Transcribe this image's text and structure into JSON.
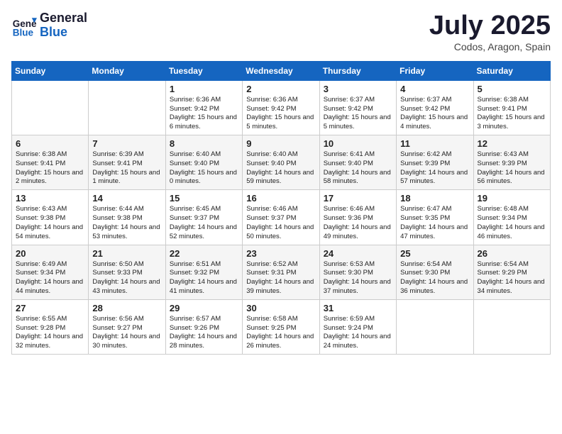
{
  "header": {
    "logo_line1": "General",
    "logo_line2": "Blue",
    "month_year": "July 2025",
    "location": "Codos, Aragon, Spain"
  },
  "weekdays": [
    "Sunday",
    "Monday",
    "Tuesday",
    "Wednesday",
    "Thursday",
    "Friday",
    "Saturday"
  ],
  "weeks": [
    [
      {
        "day": "",
        "info": ""
      },
      {
        "day": "",
        "info": ""
      },
      {
        "day": "1",
        "info": "Sunrise: 6:36 AM\nSunset: 9:42 PM\nDaylight: 15 hours and 6 minutes."
      },
      {
        "day": "2",
        "info": "Sunrise: 6:36 AM\nSunset: 9:42 PM\nDaylight: 15 hours and 5 minutes."
      },
      {
        "day": "3",
        "info": "Sunrise: 6:37 AM\nSunset: 9:42 PM\nDaylight: 15 hours and 5 minutes."
      },
      {
        "day": "4",
        "info": "Sunrise: 6:37 AM\nSunset: 9:42 PM\nDaylight: 15 hours and 4 minutes."
      },
      {
        "day": "5",
        "info": "Sunrise: 6:38 AM\nSunset: 9:41 PM\nDaylight: 15 hours and 3 minutes."
      }
    ],
    [
      {
        "day": "6",
        "info": "Sunrise: 6:38 AM\nSunset: 9:41 PM\nDaylight: 15 hours and 2 minutes."
      },
      {
        "day": "7",
        "info": "Sunrise: 6:39 AM\nSunset: 9:41 PM\nDaylight: 15 hours and 1 minute."
      },
      {
        "day": "8",
        "info": "Sunrise: 6:40 AM\nSunset: 9:40 PM\nDaylight: 15 hours and 0 minutes."
      },
      {
        "day": "9",
        "info": "Sunrise: 6:40 AM\nSunset: 9:40 PM\nDaylight: 14 hours and 59 minutes."
      },
      {
        "day": "10",
        "info": "Sunrise: 6:41 AM\nSunset: 9:40 PM\nDaylight: 14 hours and 58 minutes."
      },
      {
        "day": "11",
        "info": "Sunrise: 6:42 AM\nSunset: 9:39 PM\nDaylight: 14 hours and 57 minutes."
      },
      {
        "day": "12",
        "info": "Sunrise: 6:43 AM\nSunset: 9:39 PM\nDaylight: 14 hours and 56 minutes."
      }
    ],
    [
      {
        "day": "13",
        "info": "Sunrise: 6:43 AM\nSunset: 9:38 PM\nDaylight: 14 hours and 54 minutes."
      },
      {
        "day": "14",
        "info": "Sunrise: 6:44 AM\nSunset: 9:38 PM\nDaylight: 14 hours and 53 minutes."
      },
      {
        "day": "15",
        "info": "Sunrise: 6:45 AM\nSunset: 9:37 PM\nDaylight: 14 hours and 52 minutes."
      },
      {
        "day": "16",
        "info": "Sunrise: 6:46 AM\nSunset: 9:37 PM\nDaylight: 14 hours and 50 minutes."
      },
      {
        "day": "17",
        "info": "Sunrise: 6:46 AM\nSunset: 9:36 PM\nDaylight: 14 hours and 49 minutes."
      },
      {
        "day": "18",
        "info": "Sunrise: 6:47 AM\nSunset: 9:35 PM\nDaylight: 14 hours and 47 minutes."
      },
      {
        "day": "19",
        "info": "Sunrise: 6:48 AM\nSunset: 9:34 PM\nDaylight: 14 hours and 46 minutes."
      }
    ],
    [
      {
        "day": "20",
        "info": "Sunrise: 6:49 AM\nSunset: 9:34 PM\nDaylight: 14 hours and 44 minutes."
      },
      {
        "day": "21",
        "info": "Sunrise: 6:50 AM\nSunset: 9:33 PM\nDaylight: 14 hours and 43 minutes."
      },
      {
        "day": "22",
        "info": "Sunrise: 6:51 AM\nSunset: 9:32 PM\nDaylight: 14 hours and 41 minutes."
      },
      {
        "day": "23",
        "info": "Sunrise: 6:52 AM\nSunset: 9:31 PM\nDaylight: 14 hours and 39 minutes."
      },
      {
        "day": "24",
        "info": "Sunrise: 6:53 AM\nSunset: 9:30 PM\nDaylight: 14 hours and 37 minutes."
      },
      {
        "day": "25",
        "info": "Sunrise: 6:54 AM\nSunset: 9:30 PM\nDaylight: 14 hours and 36 minutes."
      },
      {
        "day": "26",
        "info": "Sunrise: 6:54 AM\nSunset: 9:29 PM\nDaylight: 14 hours and 34 minutes."
      }
    ],
    [
      {
        "day": "27",
        "info": "Sunrise: 6:55 AM\nSunset: 9:28 PM\nDaylight: 14 hours and 32 minutes."
      },
      {
        "day": "28",
        "info": "Sunrise: 6:56 AM\nSunset: 9:27 PM\nDaylight: 14 hours and 30 minutes."
      },
      {
        "day": "29",
        "info": "Sunrise: 6:57 AM\nSunset: 9:26 PM\nDaylight: 14 hours and 28 minutes."
      },
      {
        "day": "30",
        "info": "Sunrise: 6:58 AM\nSunset: 9:25 PM\nDaylight: 14 hours and 26 minutes."
      },
      {
        "day": "31",
        "info": "Sunrise: 6:59 AM\nSunset: 9:24 PM\nDaylight: 14 hours and 24 minutes."
      },
      {
        "day": "",
        "info": ""
      },
      {
        "day": "",
        "info": ""
      }
    ]
  ]
}
